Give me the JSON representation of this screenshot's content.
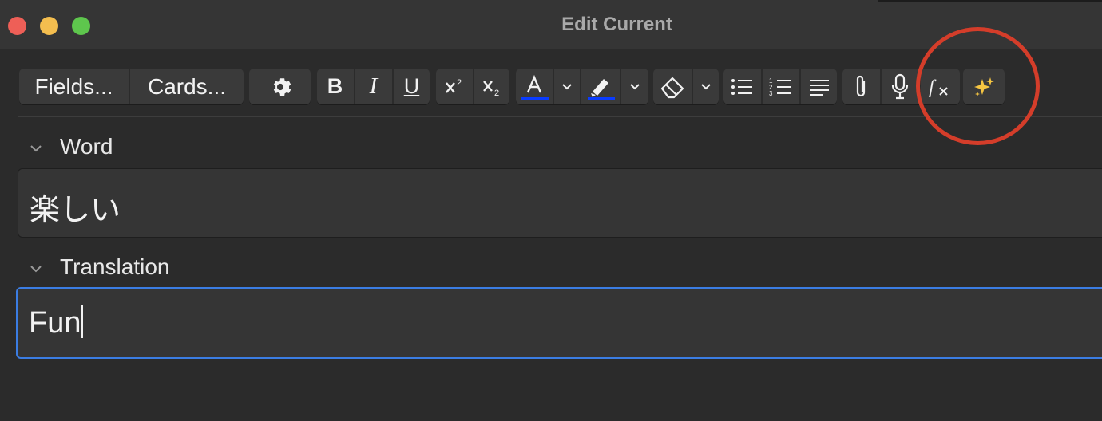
{
  "window": {
    "title": "Edit Current"
  },
  "toolbar": {
    "fields_label": "Fields...",
    "cards_label": "Cards...",
    "bold_label": "B",
    "italic_label": "I",
    "underline_label": "U",
    "text_color": "#0a3cff",
    "highlight_color": "#0a3cff"
  },
  "fields": [
    {
      "label": "Word",
      "value": "楽しい"
    },
    {
      "label": "Translation",
      "value": "Fun"
    }
  ],
  "colors": {
    "accent": "#3b7de3",
    "annotation": "#d43d2a"
  }
}
